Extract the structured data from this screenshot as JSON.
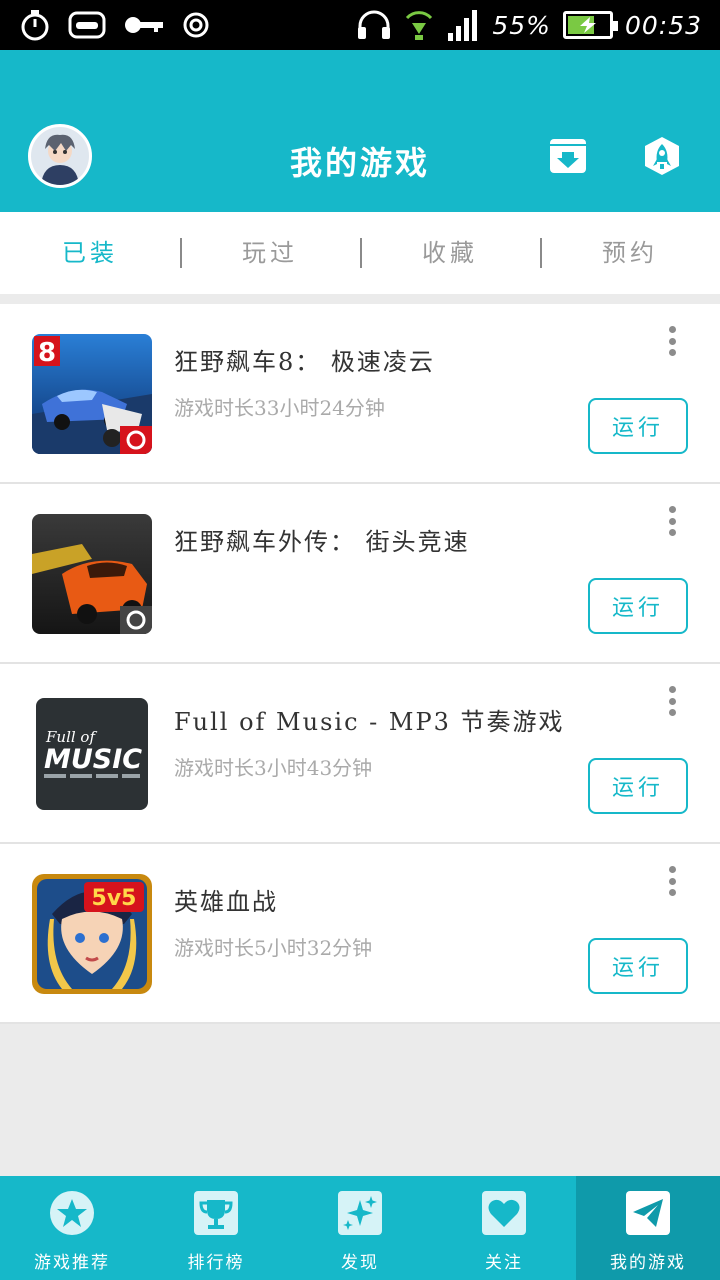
{
  "status_bar": {
    "battery": "55%",
    "time": "00:53"
  },
  "header": {
    "title": "我的游戏"
  },
  "tabs": [
    {
      "label": "已装"
    },
    {
      "label": "玩过"
    },
    {
      "label": "收藏"
    },
    {
      "label": "预约"
    }
  ],
  "games": [
    {
      "name": "狂野飙车8： 极速凌云",
      "playtime": "游戏时长33小时24分钟",
      "run_label": "运行",
      "icon": "asphalt8-icon"
    },
    {
      "name": "狂野飙车外传： 街头竞速",
      "playtime": "",
      "run_label": "运行",
      "icon": "asphalt-street-icon"
    },
    {
      "name": "Full of Music - MP3 节奏游戏",
      "playtime": "游戏时长3小时43分钟",
      "run_label": "运行",
      "icon": "full-of-music-icon",
      "icon_text_top": "Full of",
      "icon_text_main": "MUSIC"
    },
    {
      "name": "英雄血战",
      "playtime": "游戏时长5小时32分钟",
      "run_label": "运行",
      "icon": "hero-battle-icon",
      "icon_badge": "5v5"
    }
  ],
  "bottom_nav": [
    {
      "label": "游戏推荐",
      "icon": "star-icon"
    },
    {
      "label": "排行榜",
      "icon": "trophy-icon"
    },
    {
      "label": "发现",
      "icon": "sparkle-icon"
    },
    {
      "label": "关注",
      "icon": "heart-icon"
    },
    {
      "label": "我的游戏",
      "icon": "paper-plane-icon"
    }
  ],
  "colors": {
    "accent": "#16b8c9",
    "accent_dark": "#0f9aaa",
    "background": "#ebebeb"
  }
}
